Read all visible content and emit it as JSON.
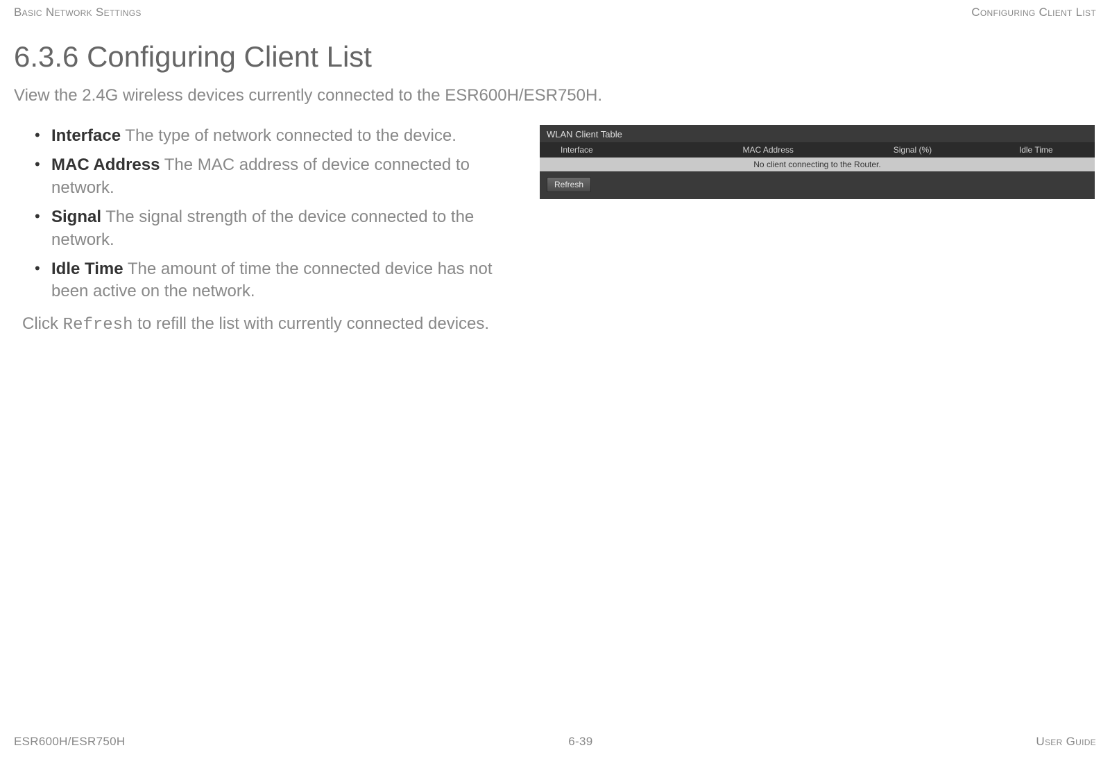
{
  "header": {
    "left": "Basic Network Settings",
    "right": "Configuring Client List"
  },
  "section": {
    "title": "6.3.6 Configuring Client List",
    "intro": "View the 2.4G wireless devices currently connected to the ESR600H/ESR750H."
  },
  "definitions": [
    {
      "term": "Interface",
      "desc": "  The type of network connected to the device."
    },
    {
      "term": "MAC Address",
      "desc": "  The MAC address of device connected to network."
    },
    {
      "term": "Signal",
      "desc": "  The signal strength of the device connected to the network."
    },
    {
      "term": "Idle Time",
      "desc": "  The amount of time the connected device has not been active on the network."
    }
  ],
  "refresh_sentence": {
    "prefix": "Click ",
    "code": "Refresh",
    "suffix": " to refill the list with currently connected devices."
  },
  "wlan": {
    "title": "WLAN Client Table",
    "columns": [
      "Interface",
      "MAC Address",
      "Signal (%)",
      "Idle Time"
    ],
    "empty_message": "No client connecting to the Router.",
    "refresh_label": "Refresh"
  },
  "footer": {
    "left": "ESR600H/ESR750H",
    "center": "6-39",
    "right": "User Guide"
  }
}
